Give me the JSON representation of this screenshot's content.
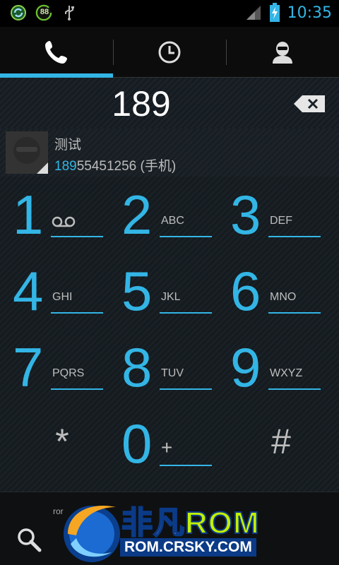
{
  "status_bar": {
    "time": "10:35",
    "battery_badge": "88",
    "icons": [
      "sync-icon",
      "battery-88-icon",
      "usb-icon",
      "signal-icon",
      "battery-charging-icon"
    ]
  },
  "tabs": [
    {
      "icon": "phone-icon",
      "selected": true
    },
    {
      "icon": "clock-icon",
      "selected": false
    },
    {
      "icon": "contact-icon",
      "selected": false
    }
  ],
  "dial": {
    "digits": "189"
  },
  "suggestion": {
    "name": "测试",
    "number_match": "189",
    "number_rest": "55451256 (手机)"
  },
  "keypad": [
    {
      "num": "1",
      "letters": "",
      "icon": "voicemail-icon"
    },
    {
      "num": "2",
      "letters": "ABC"
    },
    {
      "num": "3",
      "letters": "DEF"
    },
    {
      "num": "4",
      "letters": "GHI"
    },
    {
      "num": "5",
      "letters": "JKL"
    },
    {
      "num": "6",
      "letters": "MNO"
    },
    {
      "num": "7",
      "letters": "PQRS"
    },
    {
      "num": "8",
      "letters": "TUV"
    },
    {
      "num": "9",
      "letters": "WXYZ"
    },
    {
      "num": "*",
      "letters": ""
    },
    {
      "num": "0",
      "letters": "+"
    },
    {
      "num": "#",
      "letters": ""
    }
  ],
  "action_bar": {
    "small_label": "ror",
    "search_icon": "search-icon"
  },
  "watermark": {
    "title_cn": "非凡",
    "title_rom": "ROM",
    "url": "ROM.CRSKY.COM"
  },
  "colors": {
    "accent": "#33b5e5",
    "watermark_green": "#c3f000",
    "watermark_blue": "#0b3a86"
  }
}
